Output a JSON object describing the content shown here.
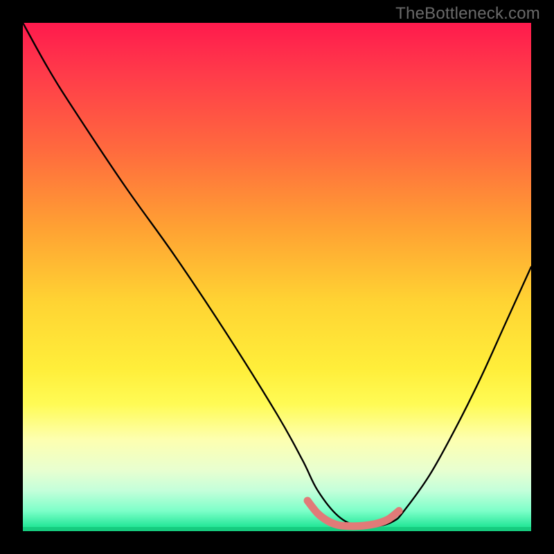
{
  "watermark": "TheBottleneck.com",
  "chart_data": {
    "type": "line",
    "title": "",
    "xlabel": "",
    "ylabel": "",
    "xlim": [
      0,
      100
    ],
    "ylim": [
      0,
      100
    ],
    "series": [
      {
        "name": "bottleneck-curve",
        "x": [
          0,
          5,
          10,
          20,
          30,
          40,
          50,
          55,
          58,
          62,
          66,
          70,
          73,
          75,
          80,
          85,
          90,
          95,
          100
        ],
        "values": [
          100,
          91,
          83,
          68,
          54,
          39,
          23,
          14,
          8,
          3,
          1,
          1,
          2,
          4,
          11,
          20,
          30,
          41,
          52
        ]
      }
    ],
    "highlight": {
      "name": "minimum-band",
      "color": "#e17a78",
      "x": [
        56,
        58,
        60,
        62,
        64,
        66,
        68,
        70,
        72,
        74
      ],
      "values": [
        6,
        3.5,
        2,
        1.2,
        1,
        1,
        1.2,
        1.6,
        2.4,
        4
      ]
    },
    "background_gradient": {
      "top": "#ff1a4d",
      "mid": "#ffee3a",
      "bottom": "#1fdc8c"
    }
  }
}
